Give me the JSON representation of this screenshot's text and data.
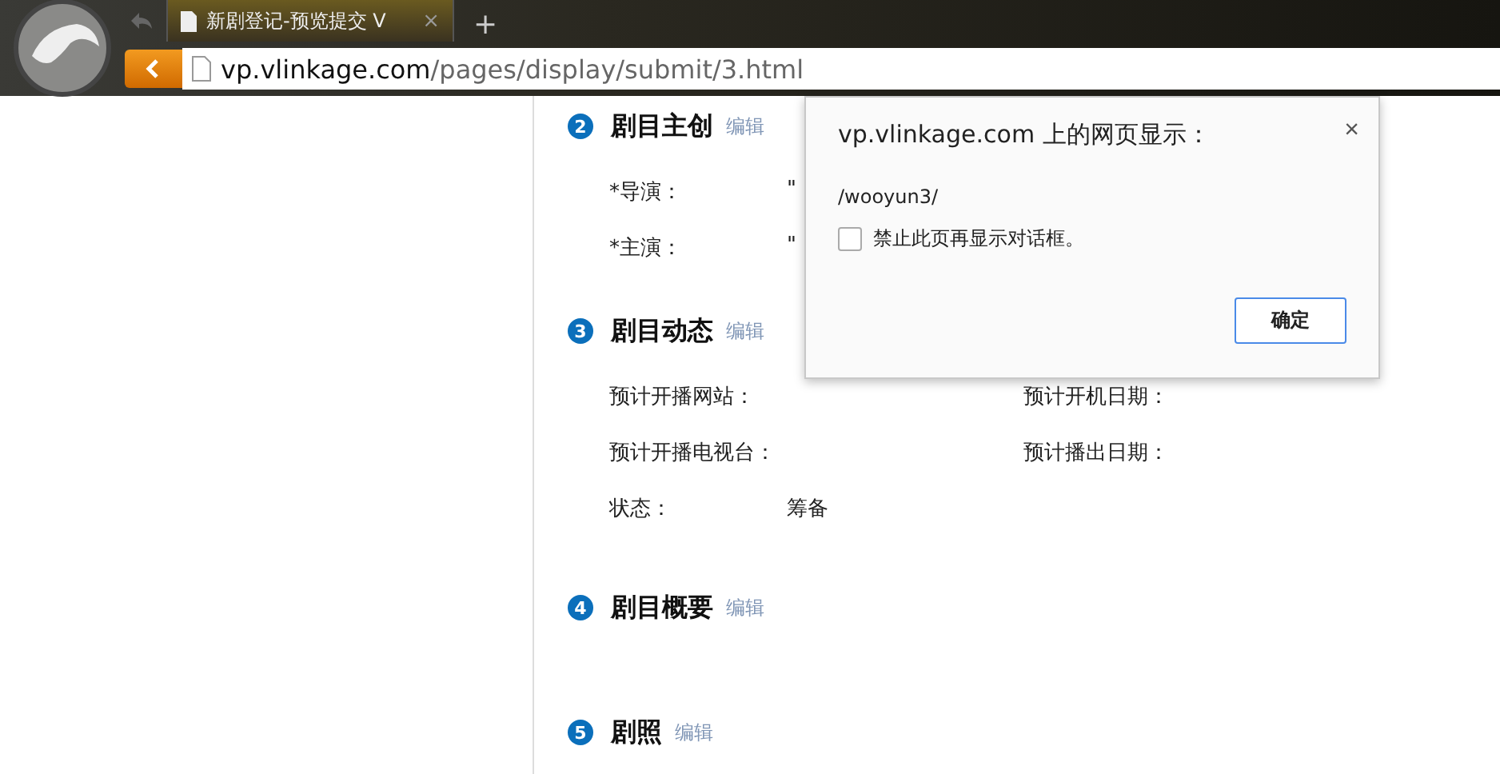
{
  "browser": {
    "tab_title": "新剧登记-预览提交 V",
    "tab_close": "×",
    "new_tab": "+",
    "url_host": "vp.vlinkage.com",
    "url_path": "/pages/display/submit/3.html"
  },
  "sections": [
    {
      "number": "2",
      "title": "剧目主创",
      "edit": "编辑",
      "rows": [
        [
          {
            "label": "*导演：",
            "value": "\""
          }
        ],
        [
          {
            "label": "*主演：",
            "value": "\""
          }
        ]
      ]
    },
    {
      "number": "3",
      "title": "剧目动态",
      "edit": "编辑",
      "rows": [
        [
          {
            "label": "预计开播网站："
          },
          {
            "label": "预计开机日期："
          }
        ],
        [
          {
            "label": "预计开播电视台："
          },
          {
            "label": "预计播出日期："
          }
        ],
        [
          {
            "label": "状态：",
            "value": "筹备"
          }
        ]
      ]
    },
    {
      "number": "4",
      "title": "剧目概要",
      "edit": "编辑"
    },
    {
      "number": "5",
      "title": "剧照",
      "edit": "编辑"
    }
  ],
  "dialog": {
    "title": "vp.vlinkage.com 上的网页显示：",
    "close": "×",
    "message": "/wooyun3/",
    "checkbox": {
      "label": "禁止此页再显示对话框。",
      "checked": false
    },
    "ok": "确定"
  }
}
